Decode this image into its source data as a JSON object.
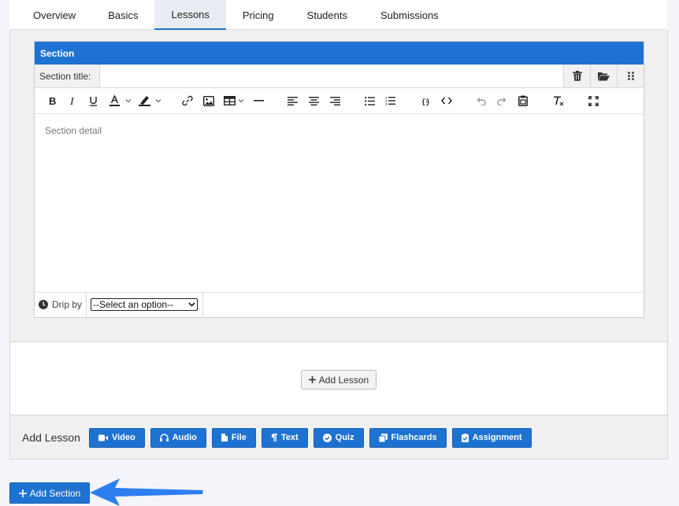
{
  "tabs": [
    "Overview",
    "Basics",
    "Lessons",
    "Pricing",
    "Students",
    "Submissions"
  ],
  "active_tab": "Lessons",
  "section": {
    "header": "Section",
    "title_label": "Section title:",
    "title_value": "",
    "detail_placeholder": "Section detail",
    "drip_label": "Drip by",
    "drip_select": "--Select an option--"
  },
  "lesson_area": {
    "add_lesson_button": "Add Lesson"
  },
  "add_lesson_bar": {
    "label": "Add Lesson",
    "buttons": [
      "Video",
      "Audio",
      "File",
      "Text",
      "Quiz",
      "Flashcards",
      "Assignment"
    ]
  },
  "add_section_button": "Add Section",
  "colors": {
    "accent": "#1e73d2",
    "arrow": "#2f7ef0"
  }
}
